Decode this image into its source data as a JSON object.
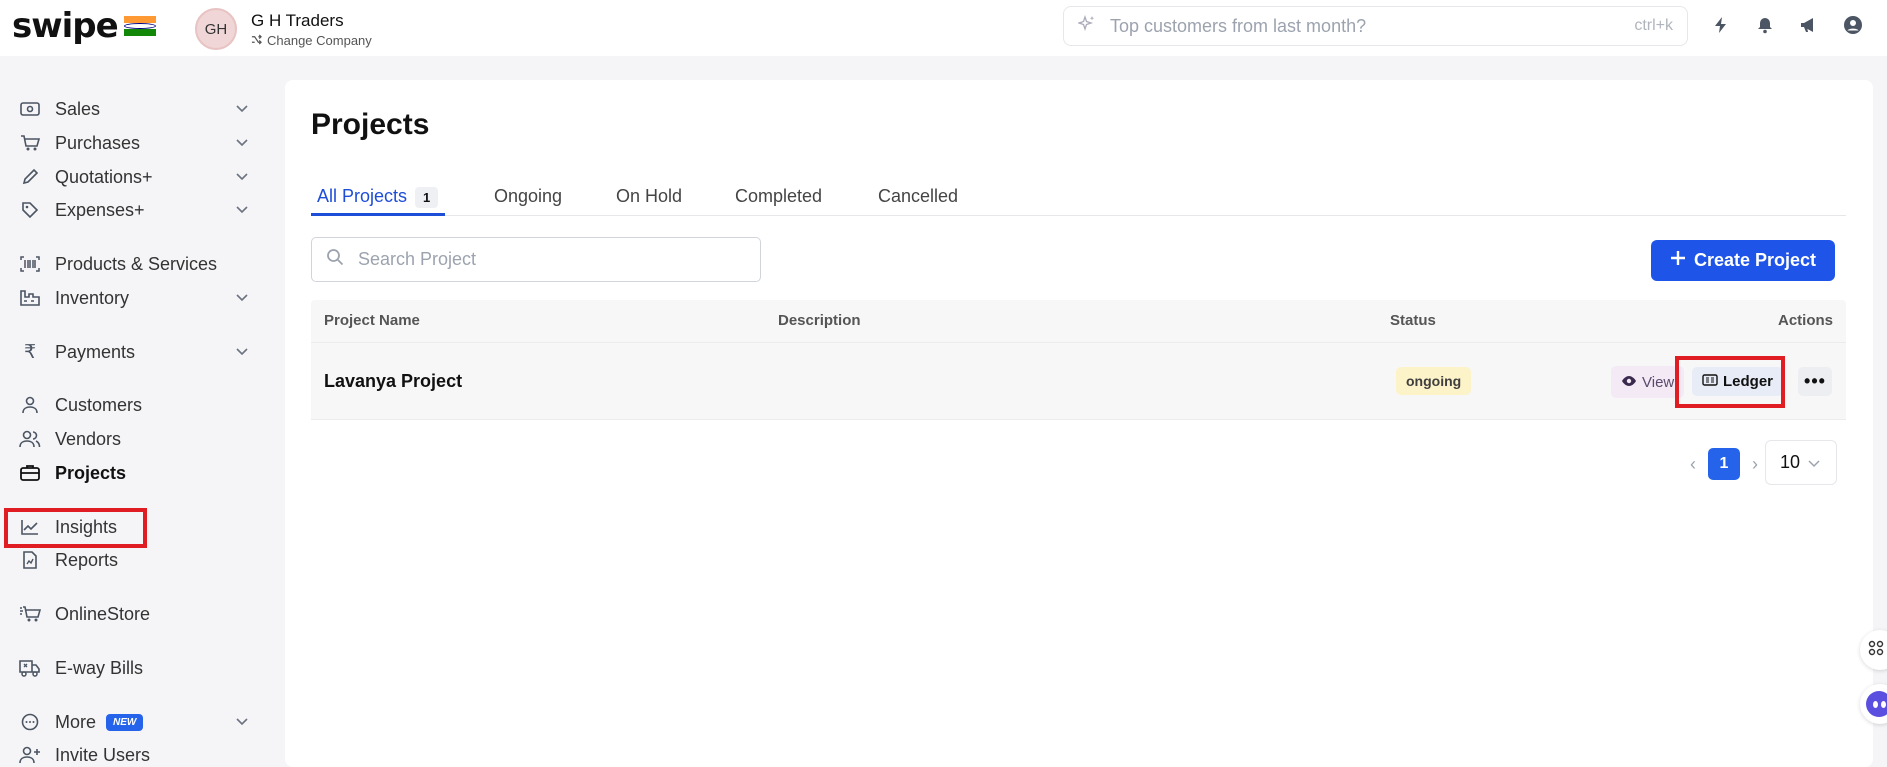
{
  "brand": {
    "logo_text": "swipe"
  },
  "company": {
    "initials": "GH",
    "name": "G H Traders",
    "change_label": "Change Company"
  },
  "top_search": {
    "placeholder": "Top customers from last month?",
    "shortcut": "ctrl+k"
  },
  "sidebar": {
    "items": [
      {
        "label": "Sales",
        "icon": "cash-icon",
        "has_chevron": true
      },
      {
        "label": "Purchases",
        "icon": "cart-icon",
        "has_chevron": true
      },
      {
        "label": "Quotations+",
        "icon": "pencil-icon",
        "has_chevron": true
      },
      {
        "label": "Expenses+",
        "icon": "tag-icon",
        "has_chevron": true
      },
      {
        "label": "Products & Services",
        "icon": "barcode-icon",
        "has_chevron": false
      },
      {
        "label": "Inventory",
        "icon": "warehouse-icon",
        "has_chevron": true
      },
      {
        "label": "Payments",
        "icon": "rupee-icon",
        "has_chevron": true
      },
      {
        "label": "Customers",
        "icon": "user-icon",
        "has_chevron": false
      },
      {
        "label": "Vendors",
        "icon": "users-icon",
        "has_chevron": false
      },
      {
        "label": "Projects",
        "icon": "briefcase-icon",
        "has_chevron": false,
        "active": true
      },
      {
        "label": "Insights",
        "icon": "chart-icon",
        "has_chevron": false
      },
      {
        "label": "Reports",
        "icon": "report-icon",
        "has_chevron": false
      },
      {
        "label": "OnlineStore",
        "icon": "store-cart-icon",
        "has_chevron": false
      },
      {
        "label": "E-way Bills",
        "icon": "truck-icon",
        "has_chevron": false
      },
      {
        "label": "More",
        "icon": "more-circle-icon",
        "has_chevron": true,
        "badge": "NEW"
      },
      {
        "label": "Invite Users",
        "icon": "user-plus-icon",
        "has_chevron": false
      }
    ]
  },
  "main": {
    "title": "Projects",
    "tabs": [
      {
        "label": "All Projects",
        "count": "1",
        "active": true
      },
      {
        "label": "Ongoing"
      },
      {
        "label": "On Hold"
      },
      {
        "label": "Completed"
      },
      {
        "label": "Cancelled"
      }
    ],
    "search_placeholder": "Search  Project",
    "create_button": "Create Project",
    "table": {
      "columns": [
        "Project Name",
        "Description",
        "Status",
        "Actions"
      ],
      "rows": [
        {
          "name": "Lavanya Project",
          "description": "",
          "status": "ongoing"
        }
      ],
      "actions": {
        "view": "View",
        "ledger": "Ledger",
        "more": "•••"
      }
    },
    "pagination": {
      "current_page": "1",
      "page_size": "10"
    }
  },
  "colors": {
    "primary": "#1e54e8",
    "highlight": "#e11d24",
    "status_ongoing_bg": "#fdf3c8"
  }
}
